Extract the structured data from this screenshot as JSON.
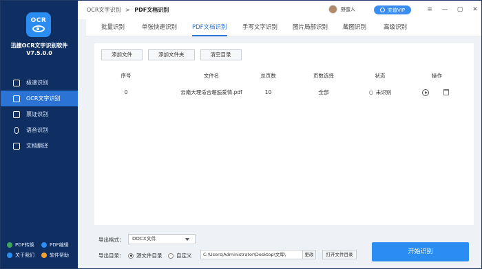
{
  "app": {
    "name": "迅捷OCR文字识别软件",
    "version": "V7.5.0.0",
    "logo_text": "OCR"
  },
  "sidebar": {
    "items": [
      {
        "label": "极速识别",
        "icon": "speed-icon"
      },
      {
        "label": "OCR文字识别",
        "icon": "ocr-icon",
        "active": true
      },
      {
        "label": "票证识别",
        "icon": "ticket-icon"
      },
      {
        "label": "语音识别",
        "icon": "mic-icon"
      },
      {
        "label": "文档翻译",
        "icon": "translate-icon"
      }
    ],
    "footer": [
      {
        "label": "PDF转换",
        "color": "#3ba55c"
      },
      {
        "label": "PDF编辑",
        "color": "#2b8cf2"
      },
      {
        "label": "关于我们",
        "color": "#2b8cf2"
      },
      {
        "label": "软件帮助",
        "color": "#f0a030"
      }
    ]
  },
  "titlebar": {
    "breadcrumb_root": "OCR文字识别",
    "breadcrumb_sep": ">",
    "breadcrumb_current": "PDF文档识别",
    "username": "野蛮人",
    "vip_label": "充值VIP"
  },
  "tabs": [
    {
      "label": "批量识别"
    },
    {
      "label": "单张快速识别"
    },
    {
      "label": "PDF文档识别",
      "active": true
    },
    {
      "label": "手写文字识别"
    },
    {
      "label": "图片局部识别"
    },
    {
      "label": "截图识别"
    },
    {
      "label": "高级识别"
    }
  ],
  "toolbar": {
    "add_file": "添加文件",
    "add_folder": "添加文件夹",
    "clear": "清空目录"
  },
  "table": {
    "headers": [
      "序号",
      "文件名",
      "总页数",
      "页数选择",
      "状态",
      "操作"
    ],
    "rows": [
      {
        "index": "0",
        "filename": "云南大理适合邂逅爱情.pdf",
        "pages": "10",
        "page_select": "全部",
        "status": "未识别"
      }
    ]
  },
  "bottom": {
    "format_label": "导出格式：",
    "format_value": "DOCX文件",
    "dir_label": "导出目录：",
    "radio_source": "源文件目录",
    "radio_custom": "自定义",
    "path_value": "C:\\Users\\Administrator\\Desktop\\文库\\",
    "change_label": "更改",
    "open_label": "打开文件目录",
    "start_label": "开始识别"
  },
  "colors": {
    "sidebar_bg": "#0f2f63",
    "accent": "#2b73d4",
    "primary_button": "#2b8cf2"
  }
}
